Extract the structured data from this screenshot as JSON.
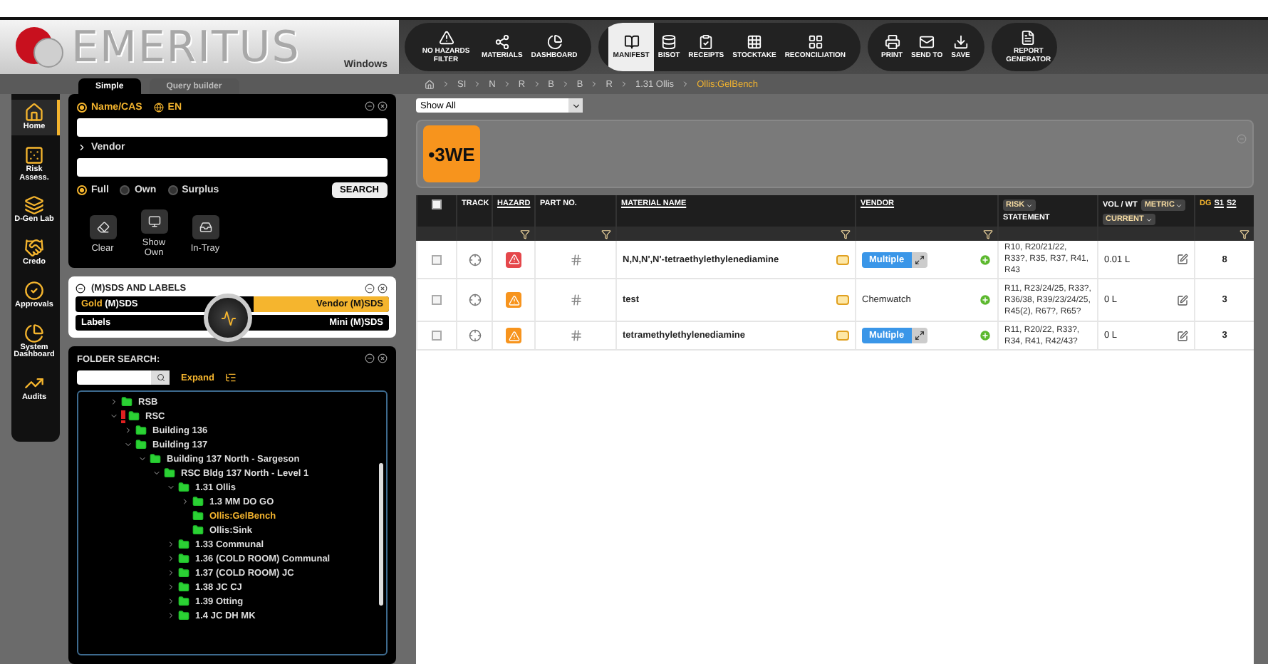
{
  "logo": {
    "name": "EMERITUS",
    "platform": "Windows"
  },
  "toolbar": [
    {
      "buttons": [
        {
          "label": "NO HAZARDS FILTER",
          "selected": false
        },
        {
          "label": "MATERIALS",
          "selected": false
        },
        {
          "label": "DASHBOARD",
          "selected": false
        }
      ]
    },
    {
      "buttons": [
        {
          "label": "MANIFEST",
          "selected": true
        },
        {
          "label": "BISOT",
          "selected": false
        },
        {
          "label": "RECEIPTS",
          "selected": false
        },
        {
          "label": "STOCKTAKE",
          "selected": false
        },
        {
          "label": "RECONCILIATION",
          "selected": false
        }
      ]
    },
    {
      "buttons": [
        {
          "label": "PRINT",
          "selected": false
        },
        {
          "label": "SEND TO",
          "selected": false
        },
        {
          "label": "SAVE",
          "selected": false
        }
      ]
    },
    {
      "buttons": [
        {
          "label": "REPORT GENERATOR",
          "selected": false
        }
      ]
    }
  ],
  "tabs": [
    {
      "label": "Simple",
      "selected": true
    },
    {
      "label": "Query builder",
      "selected": false
    }
  ],
  "breadcrumb": [
    {
      "label": "SI",
      "current": false
    },
    {
      "label": "N",
      "current": false
    },
    {
      "label": "R",
      "current": false
    },
    {
      "label": "B",
      "current": false
    },
    {
      "label": "B",
      "current": false
    },
    {
      "label": "R",
      "current": false
    },
    {
      "label": "1.31 Ollis",
      "current": false
    },
    {
      "label": "Ollis:GelBench",
      "current": true
    }
  ],
  "nav": [
    {
      "label": "Home",
      "selected": true
    },
    {
      "label": "Risk Assess.",
      "selected": false
    },
    {
      "label": "D-Gen Lab",
      "selected": false
    },
    {
      "label": "Credo",
      "selected": false
    },
    {
      "label": "Approvals",
      "selected": false
    },
    {
      "label": "System Dashboard",
      "selected": false
    },
    {
      "label": "Audits",
      "selected": false
    }
  ],
  "search": {
    "modes": [
      {
        "label": "Name/CAS",
        "selected": true
      },
      {
        "label": "EN",
        "selected": false
      }
    ],
    "vendor_label": "Vendor",
    "scopes": [
      {
        "label": "Full",
        "selected": true
      },
      {
        "label": "Own",
        "selected": false
      },
      {
        "label": "Surplus",
        "selected": false
      }
    ],
    "button": "SEARCH",
    "actions": [
      {
        "label": "Clear"
      },
      {
        "label": "Show Own"
      },
      {
        "label": "In-Tray"
      }
    ]
  },
  "sds": {
    "title": "(M)SDS AND LABELS",
    "rows": [
      {
        "left": [
          {
            "text": "Gold",
            "highlight": true
          },
          {
            "text": " (M)SDS",
            "highlight": false
          }
        ],
        "right": {
          "label": "Vendor (M)SDS",
          "selected": true
        }
      },
      {
        "left": [
          {
            "text": "Labels",
            "highlight": false
          }
        ],
        "right": {
          "label": "Mini (M)SDS",
          "selected": false
        }
      }
    ]
  },
  "folders": {
    "title": "FOLDER SEARCH:",
    "expand": "Expand",
    "tree": [
      {
        "label": "RSB",
        "kind": "branch",
        "expanded": false,
        "alert": false,
        "selected": false
      },
      {
        "label": "RSC",
        "kind": "branch",
        "expanded": true,
        "alert": true,
        "selected": false,
        "children": [
          {
            "label": "Building 136",
            "kind": "branch",
            "expanded": false,
            "alert": false,
            "selected": false
          },
          {
            "label": "Building 137",
            "kind": "branch",
            "expanded": true,
            "alert": false,
            "selected": false,
            "children": [
              {
                "label": "Building 137 North - Sargeson",
                "kind": "branch",
                "expanded": true,
                "alert": false,
                "selected": false,
                "children": [
                  {
                    "label": "RSC Bldg 137 North - Level 1",
                    "kind": "branch",
                    "expanded": true,
                    "alert": false,
                    "selected": false,
                    "children": [
                      {
                        "label": "1.31 Ollis",
                        "kind": "branch",
                        "expanded": true,
                        "alert": false,
                        "selected": false,
                        "children": [
                          {
                            "label": "1.3 MM DO GO",
                            "kind": "branch",
                            "expanded": false,
                            "alert": false,
                            "selected": false
                          },
                          {
                            "label": "Ollis:GelBench",
                            "kind": "leaf",
                            "expanded": false,
                            "alert": false,
                            "selected": true
                          },
                          {
                            "label": "Ollis:Sink",
                            "kind": "leaf",
                            "expanded": false,
                            "alert": false,
                            "selected": false
                          }
                        ]
                      },
                      {
                        "label": "1.33 Communal",
                        "kind": "branch",
                        "expanded": false,
                        "alert": false,
                        "selected": false
                      },
                      {
                        "label": "1.36 (COLD ROOM) Communal",
                        "kind": "branch",
                        "expanded": false,
                        "alert": false,
                        "selected": false
                      },
                      {
                        "label": "1.37 (COLD ROOM) JC",
                        "kind": "branch",
                        "expanded": false,
                        "alert": false,
                        "selected": false
                      },
                      {
                        "label": "1.38 JC CJ",
                        "kind": "branch",
                        "expanded": false,
                        "alert": false,
                        "selected": false
                      },
                      {
                        "label": "1.39 Otting",
                        "kind": "branch",
                        "expanded": false,
                        "alert": false,
                        "selected": false
                      },
                      {
                        "label": "1.4 JC DH MK",
                        "kind": "branch",
                        "expanded": false,
                        "alert": false,
                        "selected": false
                      }
                    ]
                  }
                ]
              }
            ]
          }
        ]
      }
    ]
  },
  "filter": {
    "value": "Show All"
  },
  "label_tile": "•3WE",
  "table": {
    "select_all": {
      "checked": false
    },
    "columns": [
      {
        "label": "TRACK",
        "underline": false,
        "filter": false
      },
      {
        "label": "HAZARD",
        "underline": true,
        "filter": true
      },
      {
        "label": "PART NO.",
        "underline": false,
        "filter": true
      },
      {
        "label": "MATERIAL NAME",
        "underline": true,
        "filter": true
      },
      {
        "label": "VENDOR",
        "underline": true,
        "filter": true
      }
    ],
    "risk": {
      "pill": "RISK",
      "label": "STATEMENT"
    },
    "vol": {
      "label": "VOL / WT",
      "units": "METRIC",
      "mode": "CURRENT"
    },
    "dg": {
      "label": "DG",
      "s1": "S1",
      "s2": "S2"
    },
    "rows": [
      {
        "checked": false,
        "color": "#e5474b",
        "name": "N,N,N',N'-tetraethylethylenediamine",
        "vendor": {
          "kind": "multiple",
          "label": "Multiple"
        },
        "risk": "R10, R20/21/22, R33?, R35, R37, R41, R43",
        "vol": "0.01 L",
        "dg": "8"
      },
      {
        "checked": false,
        "color": "#f7941d",
        "name": "test",
        "vendor": {
          "kind": "text",
          "label": "Chemwatch"
        },
        "risk": "R11, R23/24/25, R33?, R36/38, R39/23/24/25, R45(2), R67?, R65?",
        "vol": "0 L",
        "dg": "3"
      },
      {
        "checked": false,
        "color": "#f7941d",
        "name": "tetramethylethylenediamine",
        "vendor": {
          "kind": "multiple",
          "label": "Multiple"
        },
        "risk": "R11, R20/22, R33?, R34, R41, R42/43?",
        "vol": "0 L",
        "dg": "3"
      }
    ]
  }
}
